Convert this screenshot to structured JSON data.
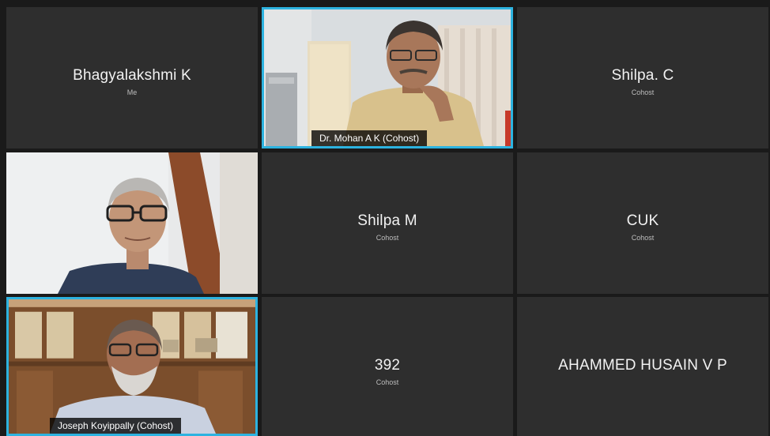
{
  "meeting": {
    "participants": [
      {
        "name": "Bhagyalakshmi K",
        "role": "Me",
        "video": false
      },
      {
        "name": "Dr. Mohan A K  (Cohost)",
        "video": true,
        "speaking": true
      },
      {
        "name": "Shilpa. C",
        "role": "Cohost",
        "video": false
      },
      {
        "name": "",
        "video": true
      },
      {
        "name": "Shilpa M",
        "role": "Cohost",
        "video": false
      },
      {
        "name": "CUK",
        "role": "Cohost",
        "video": false
      },
      {
        "name": "Joseph Koyippally  (Cohost)",
        "video": true,
        "speaking": true
      },
      {
        "name": "392",
        "role": "Cohost",
        "video": false
      },
      {
        "name": "AHAMMED HUSAIN V P",
        "role": "",
        "video": false
      }
    ],
    "colors": {
      "active_border": "#2db3e0",
      "tile_background": "#2e2e2e",
      "grid_background": "#1a1a1a"
    }
  }
}
